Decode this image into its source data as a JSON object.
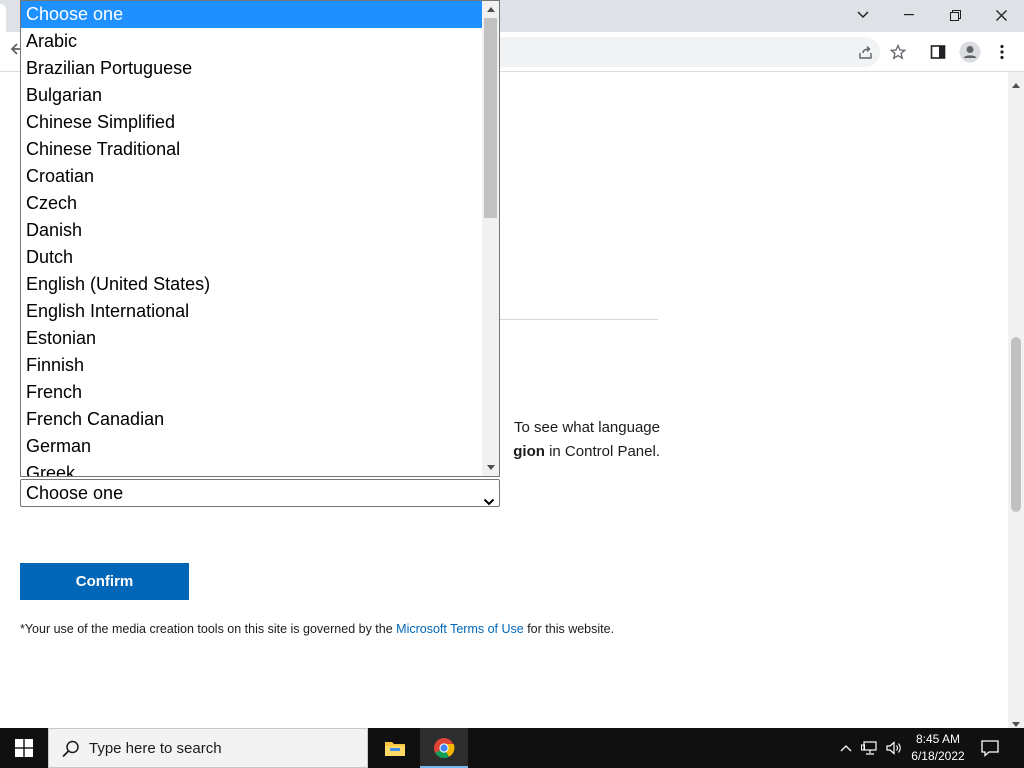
{
  "browser": {
    "window_controls": {
      "minimize": "minimize",
      "maximize": "restore",
      "close": "close"
    }
  },
  "page": {
    "note": {
      "text_before": "To see what language",
      "bold": "gion",
      "text_after": " in Control Panel."
    },
    "language_select": {
      "value": "Choose one",
      "options": [
        "Choose one",
        "Arabic",
        "Brazilian Portuguese",
        "Bulgarian",
        "Chinese Simplified",
        "Chinese Traditional",
        "Croatian",
        "Czech",
        "Danish",
        "Dutch",
        "English (United States)",
        "English International",
        "Estonian",
        "Finnish",
        "French",
        "French Canadian",
        "German",
        "Greek"
      ],
      "highlighted": "Choose one"
    },
    "confirm_label": "Confirm",
    "terms": {
      "before": "*Your use of the media creation tools on this site is governed by the ",
      "link": "Microsoft Terms of Use",
      "after": " for this website."
    }
  },
  "taskbar": {
    "search_placeholder": "Type here to search",
    "time": "8:45 AM",
    "date": "6/18/2022"
  },
  "colors": {
    "accent": "#0067b8",
    "selected_option": "#1e90ff",
    "taskbar": "#101010"
  }
}
